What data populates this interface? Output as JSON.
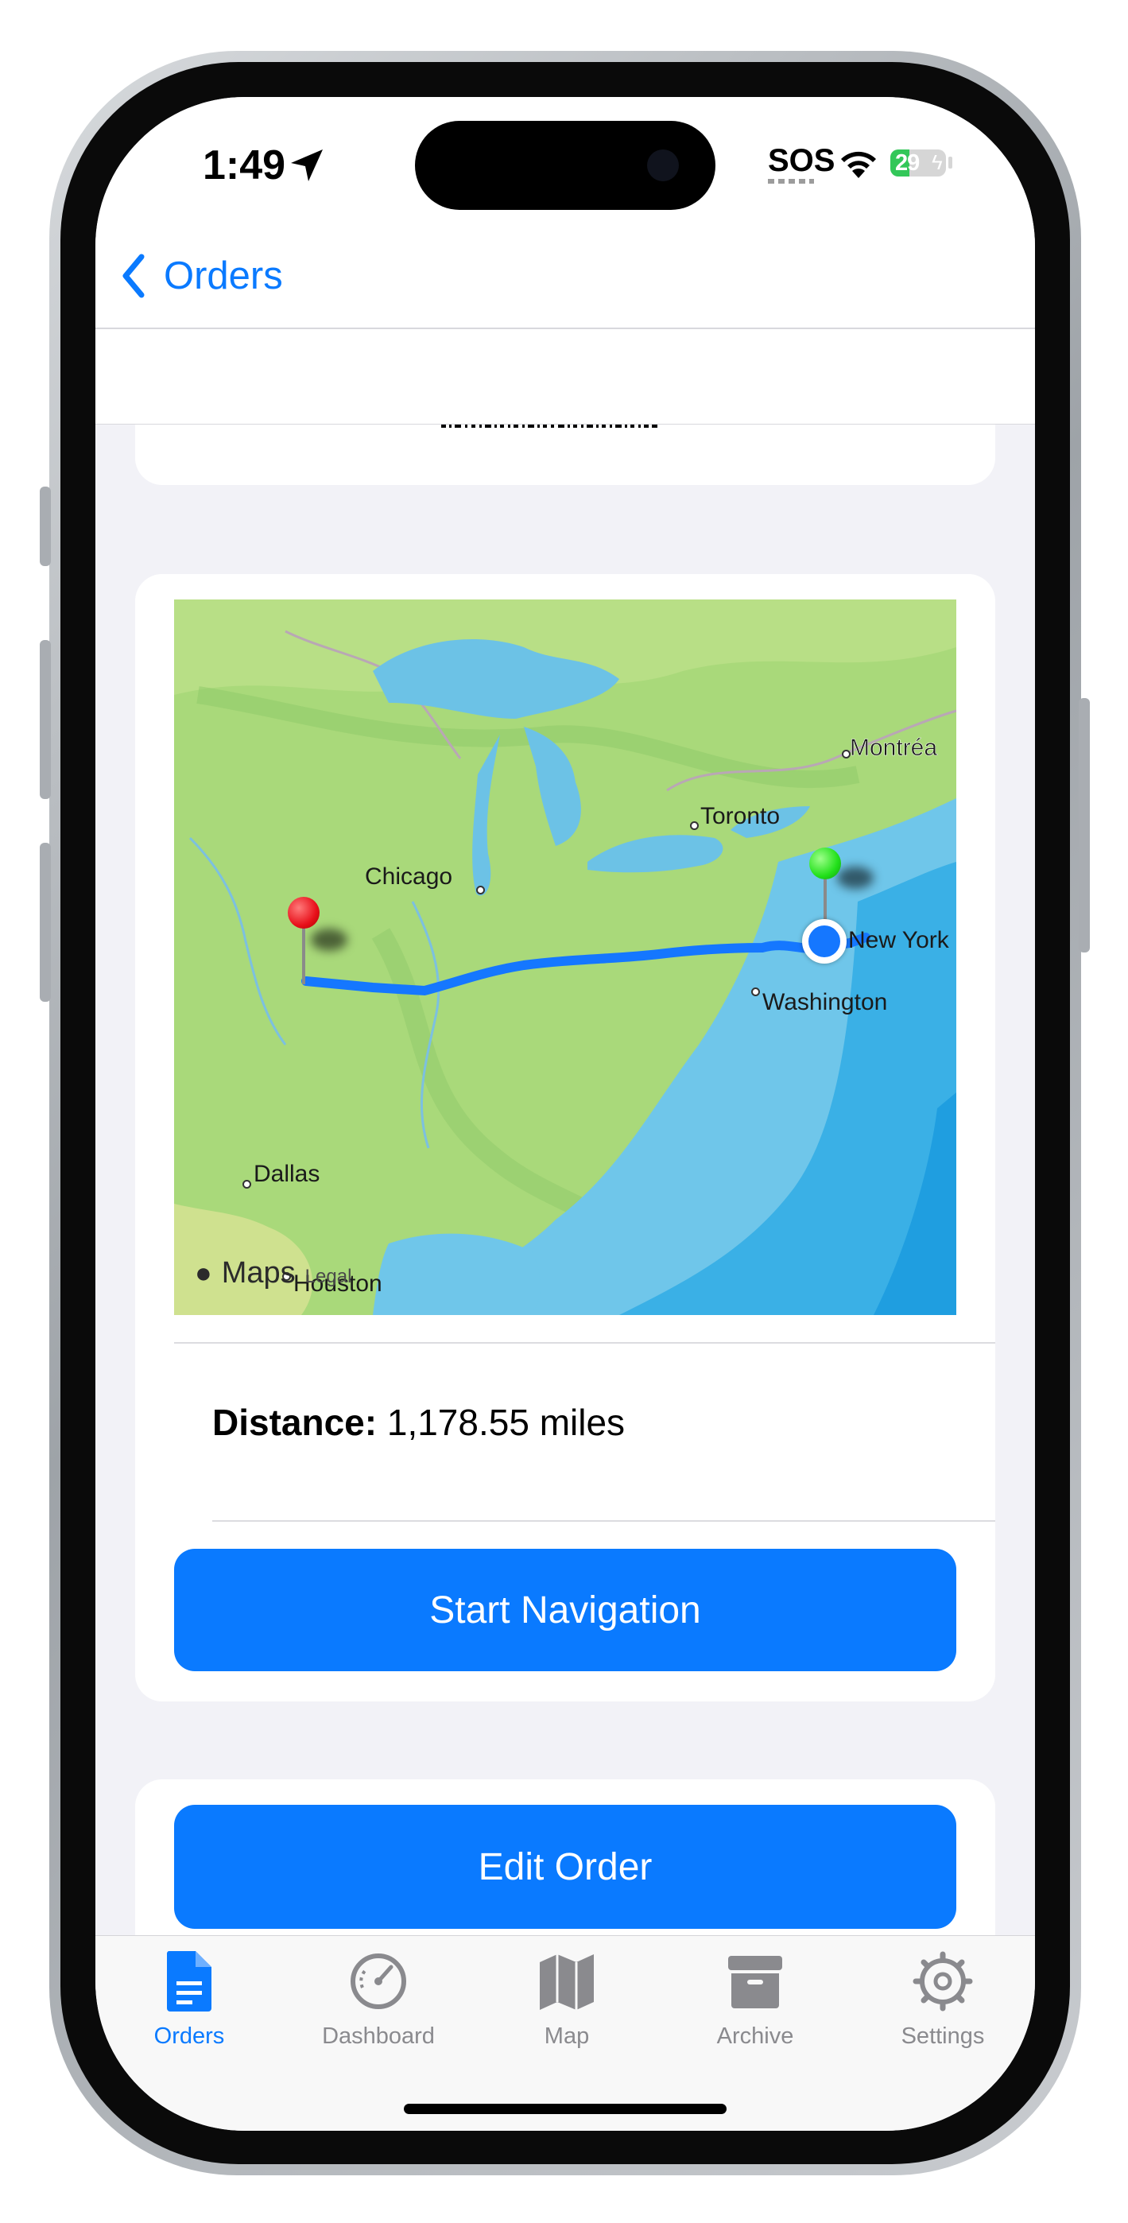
{
  "status": {
    "time": "1:49",
    "sos": "SOS",
    "battery": "29"
  },
  "nav": {
    "back_label": "Orders"
  },
  "map": {
    "cities": {
      "montreal": "Montréa",
      "toronto": "Toronto",
      "chicago": "Chicago",
      "new_york": "New York",
      "washington": "Washington",
      "dallas": "Dallas",
      "houston": "Houston"
    },
    "attribution": {
      "brand": "Maps",
      "legal": "Legal"
    }
  },
  "route": {
    "distance_label": "Distance:",
    "distance_value": "1,178.55 miles"
  },
  "buttons": {
    "start_navigation": "Start Navigation",
    "edit_order": "Edit Order"
  },
  "tabs": [
    {
      "label": "Orders",
      "icon": "document-icon",
      "active": true
    },
    {
      "label": "Dashboard",
      "icon": "gauge-icon"
    },
    {
      "label": "Map",
      "icon": "map-icon"
    },
    {
      "label": "Archive",
      "icon": "archive-icon"
    },
    {
      "label": "Settings",
      "icon": "gear-icon"
    }
  ],
  "colors": {
    "accent": "#0A7AFF",
    "pin_start": "#E8101A",
    "pin_end": "#22E01A",
    "route": "#1577FF"
  }
}
